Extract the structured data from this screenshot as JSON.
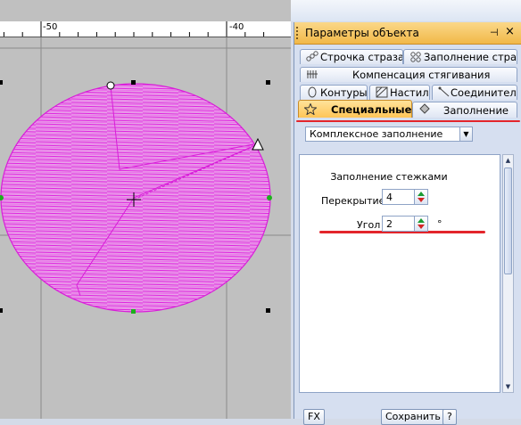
{
  "ruler": {
    "labels": [
      "-50",
      "-40"
    ]
  },
  "panel": {
    "title": "Параметры объекта",
    "pin_glyph": "⊣",
    "close_glyph": "×"
  },
  "tabs": {
    "row1": [
      "Строчка страза...",
      "Заполнение страз..."
    ],
    "row2": [
      "Компенсация стягивания"
    ],
    "row3": [
      "Контуры",
      "Настил",
      "Соединители"
    ],
    "row4": [
      "Специальные",
      "Заполнение"
    ],
    "active": "Специальные"
  },
  "fill_type": {
    "selected": "Комплексное заполнение"
  },
  "stitch_fill": {
    "group_title": "Заполнение стежками",
    "overlap_label": "Перекрытие",
    "overlap_value": "4",
    "angle_label": "Угол",
    "angle_value": "2",
    "angle_unit": "°"
  },
  "buttons": {
    "fx": "FX",
    "save": "Сохранить",
    "help": "?"
  },
  "colors": {
    "stitch": "#e020e0",
    "highlight": "#e3252b",
    "tab_active": "#ffc557",
    "canvas": "#c0c0c0"
  }
}
